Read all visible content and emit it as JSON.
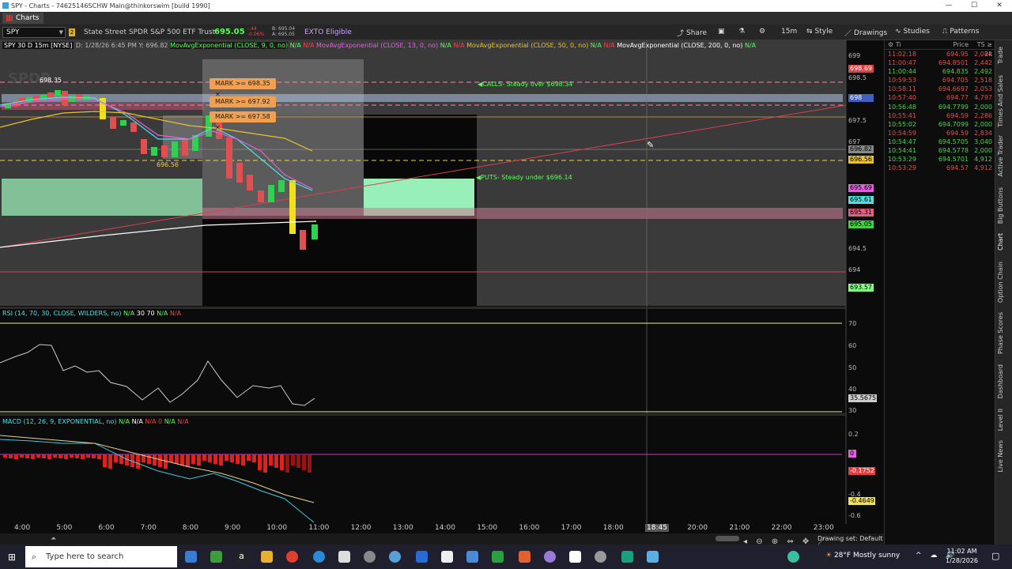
{
  "window": {
    "title": "SPY - Charts - 74625146SCHW Main@thinkorswim [build 1990]",
    "controls": [
      "—",
      "☐",
      "✕"
    ]
  },
  "tabs": {
    "charts": "Charts"
  },
  "toolbar": {
    "symbol": "SPY",
    "name": "State Street SPDR S&P 500 ETF Trust",
    "last": "695.05",
    "change": "-.44",
    "change_pct": "-0.06%",
    "bid": "B: 695.04",
    "ask": "A: 695.05",
    "exto": "EXTO Eligible",
    "share": "Share",
    "timeframe": "15m",
    "style": "Style",
    "drawings": "Drawings",
    "studies": "Studies",
    "patterns": "Patterns"
  },
  "chart": {
    "header_symbol": "SPY 30 D 15m [NYSE]",
    "header_info": "D: 1/28/26 6:45 PM  Y: 696.82",
    "ma_labels": [
      {
        "text": "MovAvgExponential (CLOSE, 9, 0, no)",
        "color": "#ffffff"
      },
      {
        "text": "MovAvgExponential (CLOSE, 13, 0, no)",
        "color": "#ff60ff"
      },
      {
        "text": "MovAvgExponential (CLOSE, 50, 0, no)",
        "color": "#e8c030"
      },
      {
        "text": "MovAvgExponential (CLOSE, 200, 0, no)",
        "color": "#ffffff"
      }
    ],
    "na": "N/A",
    "price_axis": [
      "699",
      "698.5",
      "697.5",
      "697",
      "694.5",
      "694"
    ],
    "price_tags": [
      {
        "text": "698.69",
        "bg": "#e04040"
      },
      {
        "text": "698",
        "bg": "#4060c0"
      },
      {
        "text": "696.82",
        "bg": "#888888"
      },
      {
        "text": "696.56",
        "bg": "#e8c030"
      },
      {
        "text": "695.69",
        "bg": "#e060e0"
      },
      {
        "text": "695.61",
        "bg": "#50e0e0"
      },
      {
        "text": "695.31",
        "bg": "#e06080"
      },
      {
        "text": "695.05",
        "bg": "#40d040"
      },
      {
        "text": "693.57",
        "bg": "#80ff80"
      }
    ],
    "marks": [
      "MARK >= 698.35 ✕",
      "MARK >= 697.92 ✕",
      "MARK >= 697.58 ✕"
    ],
    "level_high": "698.35",
    "level_low": "696.56",
    "calls_note": "CALLS- Steady over $698.34",
    "puts_note": "PUTS- Steady under $696.14",
    "watermark": "SPDR"
  },
  "rsi": {
    "header": "RSI (14, 70, 30, CLOSE, WILDERS, no)",
    "v30": "30",
    "v70": "70",
    "axis": [
      "70",
      "60",
      "50",
      "40",
      "30"
    ],
    "tag": "35.5675"
  },
  "macd": {
    "header": "MACD (12, 26, 9, EXPONENTIAL, no)",
    "v0": "0",
    "axis": [
      "0.2",
      "-0.4",
      "-0.6"
    ],
    "tags": [
      {
        "text": "0",
        "bg": "#e060e0"
      },
      {
        "text": "-0.1752",
        "bg": "#e04040"
      },
      {
        "text": "-0.4649",
        "bg": "#f0e060"
      }
    ]
  },
  "time_axis": [
    "4:00",
    "5:00",
    "6:00",
    "7:00",
    "8:00",
    "9:00",
    "10:00",
    "11:00",
    "12:00",
    "13:00",
    "14:00",
    "15:00",
    "16:00",
    "17:00",
    "18:00",
    "18:45",
    "20:00",
    "21:00",
    "22:00",
    "23:00"
  ],
  "status": {
    "drawing_set": "Drawing set: Default"
  },
  "times_sales": {
    "headers": [
      "Ti",
      "Price",
      "TS ≥ 2k"
    ],
    "rows": [
      {
        "time": "11:02:18",
        "price": "694.95",
        "size": "2,084",
        "dir": "r"
      },
      {
        "time": "11:00:47",
        "price": "694.8501",
        "size": "2,442",
        "dir": "r"
      },
      {
        "time": "11:00:44",
        "price": "694.835",
        "size": "2,492",
        "dir": "g"
      },
      {
        "time": "10:59:53",
        "price": "694.705",
        "size": "2,518",
        "dir": "r"
      },
      {
        "time": "10:58:11",
        "price": "694.6697",
        "size": "2,053",
        "dir": "r"
      },
      {
        "time": "10:57:40",
        "price": "694.77",
        "size": "4,797",
        "dir": "r"
      },
      {
        "time": "10:56:48",
        "price": "694.7799",
        "size": "2,000",
        "dir": "g"
      },
      {
        "time": "10:55:41",
        "price": "694.59",
        "size": "2,286",
        "dir": "r"
      },
      {
        "time": "10:55:02",
        "price": "694.7099",
        "size": "2,000",
        "dir": "g"
      },
      {
        "time": "10:54:59",
        "price": "694.59",
        "size": "2,834",
        "dir": "r"
      },
      {
        "time": "10:54:47",
        "price": "694.5705",
        "size": "3,040",
        "dir": "g"
      },
      {
        "time": "10:54:41",
        "price": "694.5778",
        "size": "2,000",
        "dir": "g"
      },
      {
        "time": "10:53:29",
        "price": "694.5701",
        "size": "4,912",
        "dir": "g"
      },
      {
        "time": "10:53:29",
        "price": "694.57",
        "size": "4,912",
        "dir": "r"
      }
    ]
  },
  "right_tabs": [
    "Trade",
    "Times And Sales",
    "Active Trader",
    "Big Buttons",
    "Chart",
    "Option Chain",
    "Phase Scores",
    "Dashboard",
    "Level II",
    "Live News"
  ],
  "taskbar": {
    "search_placeholder": "Type here to search",
    "weather": "28°F  Mostly sunny",
    "time": "11:02 AM",
    "date": "1/28/2026"
  }
}
